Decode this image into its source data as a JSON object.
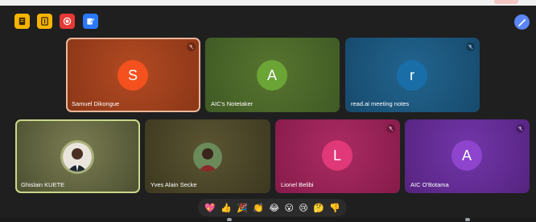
{
  "toolbar": {
    "buttons": [
      {
        "icon": "document-icon",
        "color": "#f6b400"
      },
      {
        "icon": "notes-icon",
        "color": "#f6b400"
      },
      {
        "icon": "record-icon",
        "color": "#e53935"
      },
      {
        "icon": "edit-icon",
        "color": "#2979ff"
      }
    ],
    "right_button_icon": "magic-wand-icon"
  },
  "participants": [
    {
      "name": "Samuel Dikongue",
      "initial": "S",
      "tile_color": "#a9431c",
      "avatar_color": "#f4511e",
      "muted": true,
      "active_speaker": true
    },
    {
      "name": "AIC's Notetaker",
      "initial": "A",
      "tile_color": "#4f6b2b",
      "avatar_color": "#6aa535",
      "muted": false
    },
    {
      "name": "read.ai meeting notes",
      "initial": "r",
      "tile_color": "#1e5a82",
      "avatar_color": "#1a6ea8",
      "muted": true
    },
    {
      "name": "Ghislain KUETE",
      "initial": "",
      "tile_color": "#5b5f3a",
      "muted": false,
      "photo": true,
      "active_speaker": true
    },
    {
      "name": "Yves Alain Secke",
      "initial": "",
      "tile_color": "#4e4a2a",
      "muted": false,
      "photo": true
    },
    {
      "name": "Lionel Belibi",
      "initial": "L",
      "tile_color": "#a2235a",
      "avatar_color": "#e03878",
      "muted": true
    },
    {
      "name": "AIC O'Botama",
      "initial": "A",
      "tile_color": "#6a2fa0",
      "avatar_color": "#8e44cc",
      "muted": true
    }
  ],
  "reactions": [
    "💖",
    "👍",
    "🎉",
    "👏",
    "😂",
    "😮",
    "😢",
    "🤔",
    "👎"
  ]
}
